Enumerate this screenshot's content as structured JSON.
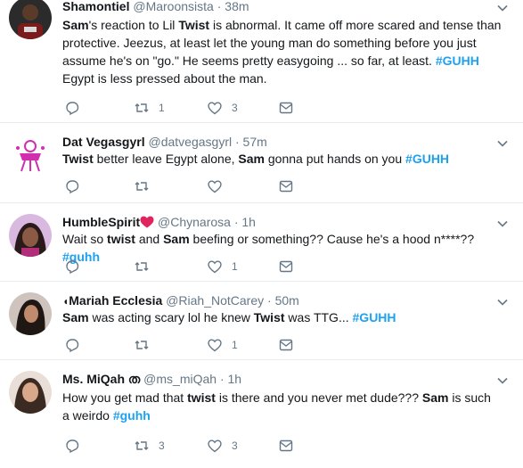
{
  "tweets": [
    {
      "name": "Shamontiel",
      "handle": "@Maroonsista",
      "sep": "·",
      "time": "38m",
      "segments": [
        {
          "t": "Sam",
          "b": true
        },
        {
          "t": "'s reaction to Lil "
        },
        {
          "t": "Twist",
          "b": true
        },
        {
          "t": " is abnormal. It came off more scared and tense than protective. Jeezus, at least let the young man do something before you just assume he's on \"go.\" He seems pretty easygoing ... so far, at least. "
        },
        {
          "t": "#GUHH",
          "h": true
        },
        {
          "t": " Egypt is less pressed about the man."
        }
      ],
      "retweets": "1",
      "likes": "3"
    },
    {
      "name": "Dat Vegasgyrl",
      "handle": "@datvegasgyrl",
      "sep": "·",
      "time": "57m",
      "segments": [
        {
          "t": "Twist",
          "b": true
        },
        {
          "t": " better leave Egypt alone, "
        },
        {
          "t": "Sam",
          "b": true
        },
        {
          "t": " gonna put hands on you  "
        },
        {
          "t": "#GUHH",
          "h": true
        }
      ],
      "retweets": "",
      "likes": ""
    },
    {
      "name": "HumbleSpirit",
      "handle": "@Chynarosa",
      "sep": "·",
      "time": "1h",
      "segments": [
        {
          "t": "Wait so "
        },
        {
          "t": "twist",
          "b": true
        },
        {
          "t": " and "
        },
        {
          "t": "Sam",
          "b": true
        },
        {
          "t": " beefing or something?? Cause he's a hood n****??  "
        },
        {
          "t": "#guhh",
          "h": true
        }
      ],
      "retweets": "",
      "likes": "1"
    },
    {
      "name": "Mariah Ecclesia",
      "handle": "@Riah_NotCarey",
      "sep": "·",
      "time": "50m",
      "segments": [
        {
          "t": "Sam",
          "b": true
        },
        {
          "t": " was acting scary lol he knew "
        },
        {
          "t": "Twist",
          "b": true
        },
        {
          "t": " was TTG... "
        },
        {
          "t": "#GUHH",
          "h": true
        }
      ],
      "retweets": "",
      "likes": "1"
    },
    {
      "name": "Ms. MiQah",
      "handle": "@ms_miQah",
      "sep": "·",
      "time": "1h",
      "segments": [
        {
          "t": "How you get mad that "
        },
        {
          "t": "twist",
          "b": true
        },
        {
          "t": " is there and you never met dude??? "
        },
        {
          "t": "Sam",
          "b": true
        },
        {
          "t": " is such a weirdo "
        },
        {
          "t": "#guhh",
          "h": true
        }
      ],
      "retweets": "3",
      "likes": "3"
    }
  ],
  "colors": {
    "hashtag": "#1da1f2",
    "meta": "#657786",
    "divider": "#e6ecf0",
    "heart": "#e0245e"
  },
  "icons": [
    "reply-icon",
    "retweet-icon",
    "like-icon",
    "direct-message-icon",
    "caret-down-icon"
  ]
}
